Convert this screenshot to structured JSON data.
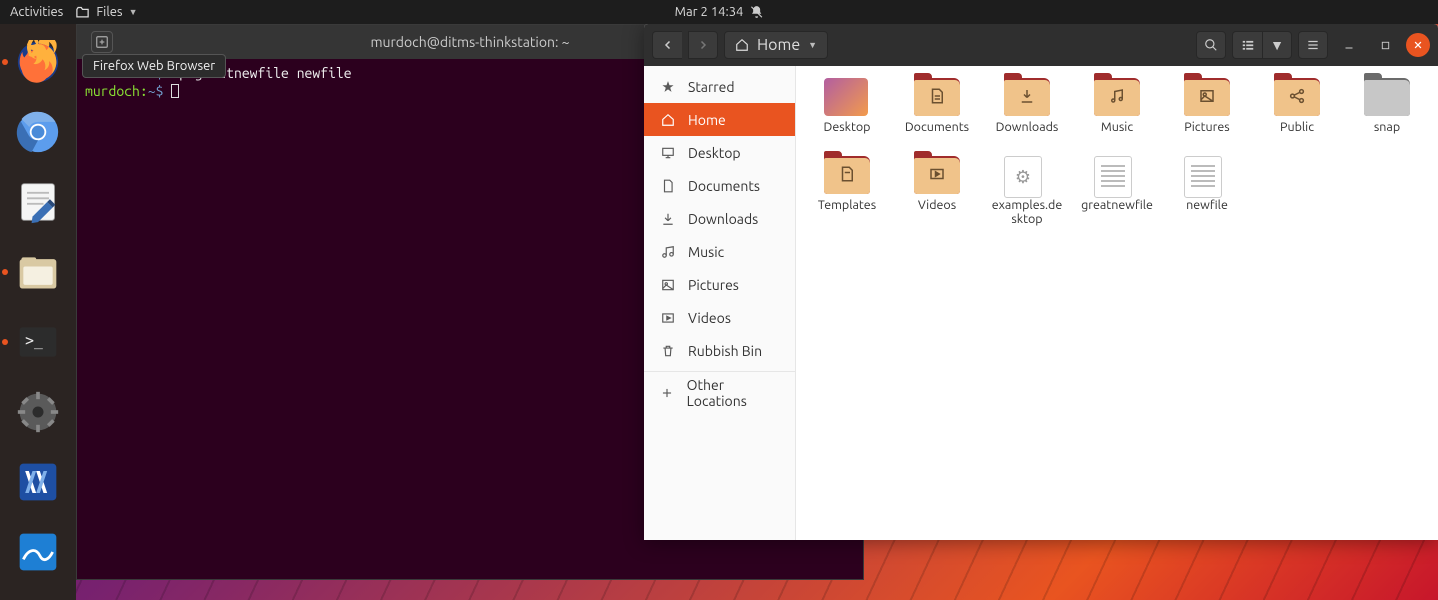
{
  "topbar": {
    "activities": "Activities",
    "app_label": "Files",
    "datetime": "Mar 2  14:34"
  },
  "dock": {
    "tooltip": "Firefox Web Browser",
    "items": [
      {
        "name": "firefox",
        "active": true
      },
      {
        "name": "chromium"
      },
      {
        "name": "text-editor"
      },
      {
        "name": "files",
        "running": true
      },
      {
        "name": "terminal",
        "running": true
      },
      {
        "name": "settings"
      },
      {
        "name": "virtualbox"
      },
      {
        "name": "wireshark"
      }
    ]
  },
  "terminal": {
    "title": "murdoch@ditms-thinkstation: ~",
    "line1_prompt_user": "Murdoch:",
    "line1_prompt_path": "~$",
    "line1_cmd": "cp greatnewfile newfile",
    "line2_prompt_user": "murdoch:",
    "line2_prompt_path": "~$"
  },
  "files": {
    "path_label": "Home",
    "sidebar": [
      {
        "icon": "star",
        "label": "Starred"
      },
      {
        "icon": "home",
        "label": "Home",
        "active": true
      },
      {
        "icon": "desktop",
        "label": "Desktop"
      },
      {
        "icon": "doc",
        "label": "Documents"
      },
      {
        "icon": "download",
        "label": "Downloads"
      },
      {
        "icon": "music",
        "label": "Music"
      },
      {
        "icon": "picture",
        "label": "Pictures"
      },
      {
        "icon": "video",
        "label": "Videos"
      },
      {
        "icon": "trash",
        "label": "Rubbish Bin"
      }
    ],
    "other_locations": "Other Locations",
    "grid": [
      {
        "type": "grad",
        "label": "Desktop"
      },
      {
        "type": "folder",
        "badge": "doc",
        "label": "Documents"
      },
      {
        "type": "folder",
        "badge": "down",
        "label": "Downloads"
      },
      {
        "type": "folder",
        "badge": "music",
        "label": "Music"
      },
      {
        "type": "folder",
        "badge": "pic",
        "label": "Pictures"
      },
      {
        "type": "folder",
        "badge": "share",
        "label": "Public"
      },
      {
        "type": "folder-gray",
        "label": "snap"
      },
      {
        "type": "folder",
        "badge": "tmpl",
        "label": "Templates"
      },
      {
        "type": "folder",
        "badge": "vid",
        "label": "Videos"
      },
      {
        "type": "gearfile",
        "label": "examples.desktop"
      },
      {
        "type": "textfile",
        "label": "greatnewfile"
      },
      {
        "type": "textfile",
        "label": "newfile"
      }
    ]
  }
}
